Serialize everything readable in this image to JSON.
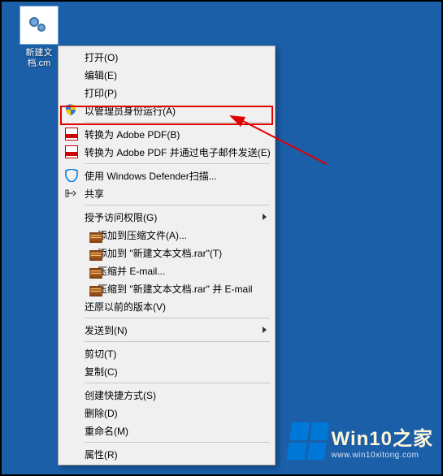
{
  "desktop": {
    "file_label_line1": "新建文",
    "file_label_line2": "档.cm"
  },
  "menu": {
    "open": "打开(O)",
    "edit": "编辑(E)",
    "print": "打印(P)",
    "run_as_admin": "以管理员身份运行(A)",
    "to_adobe_pdf": "转换为 Adobe PDF(B)",
    "to_pdf_email": "转换为 Adobe PDF 并通过电子邮件发送(E)",
    "defender": "使用 Windows Defender扫描...",
    "share": "共享",
    "grant_access": "授予访问权限(G)",
    "add_to_archive": "添加到压缩文件(A)...",
    "add_to_rar": "添加到 \"新建文本文档.rar\"(T)",
    "compress_email": "压缩并 E-mail...",
    "compress_to_email": "压缩到 \"新建文本文档.rar\" 并 E-mail",
    "restore_prev": "还原以前的版本(V)",
    "send_to": "发送到(N)",
    "cut": "剪切(T)",
    "copy": "复制(C)",
    "create_shortcut": "创建快捷方式(S)",
    "delete": "删除(D)",
    "rename": "重命名(M)",
    "properties": "属性(R)"
  },
  "branding": {
    "title": "Win10之家",
    "url": "www.win10xitong.com"
  }
}
